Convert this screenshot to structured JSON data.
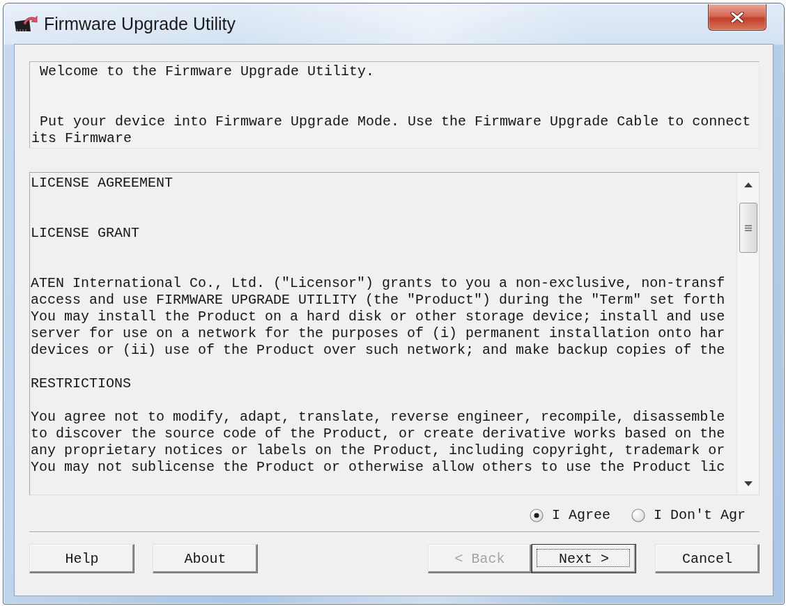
{
  "window": {
    "title": "Firmware Upgrade Utility"
  },
  "welcome": {
    "greeting": "Welcome to the Firmware Upgrade Utility.",
    "instructions": [
      "Put your device into Firmware Upgrade Mode. Use the Firmware Upgrade Cable to connect",
      "its Firmware"
    ]
  },
  "license": {
    "title": "LICENSE AGREEMENT",
    "sections": [
      {
        "heading": "LICENSE GRANT",
        "lines": [
          "ATEN International Co., Ltd. (\"Licensor\") grants to you a non-exclusive, non-transf",
          "access and use FIRMWARE UPGRADE UTILITY (the \"Product\") during the \"Term\" set forth",
          "You may install the Product on a hard disk or other storage device; install and use",
          "server for use on a network for the purposes of (i) permanent installation onto har",
          "devices or (ii) use of the Product over such network; and make backup copies of the"
        ]
      },
      {
        "heading": "RESTRICTIONS",
        "lines": [
          "You agree not to modify, adapt, translate, reverse engineer, recompile, disassemble",
          "to discover the source code of the Product, or create derivative works based on the",
          "any proprietary notices or labels on the Product, including copyright, trademark or",
          "You may not sublicense the Product or otherwise allow others to use the Product lic"
        ]
      }
    ]
  },
  "agreement": {
    "options": [
      {
        "label": "I Agree",
        "selected": true
      },
      {
        "label": "I Don't Agr",
        "selected": false
      }
    ]
  },
  "footer": {
    "left_buttons": [
      {
        "label": "Help",
        "disabled": false,
        "focused": false
      },
      {
        "label": "About",
        "disabled": false,
        "focused": false
      }
    ],
    "nav_buttons": [
      {
        "label": "< Back",
        "disabled": true,
        "focused": false
      },
      {
        "label": "Next >",
        "disabled": false,
        "focused": true
      }
    ],
    "right_buttons": [
      {
        "label": "Cancel",
        "disabled": false,
        "focused": false
      }
    ]
  }
}
